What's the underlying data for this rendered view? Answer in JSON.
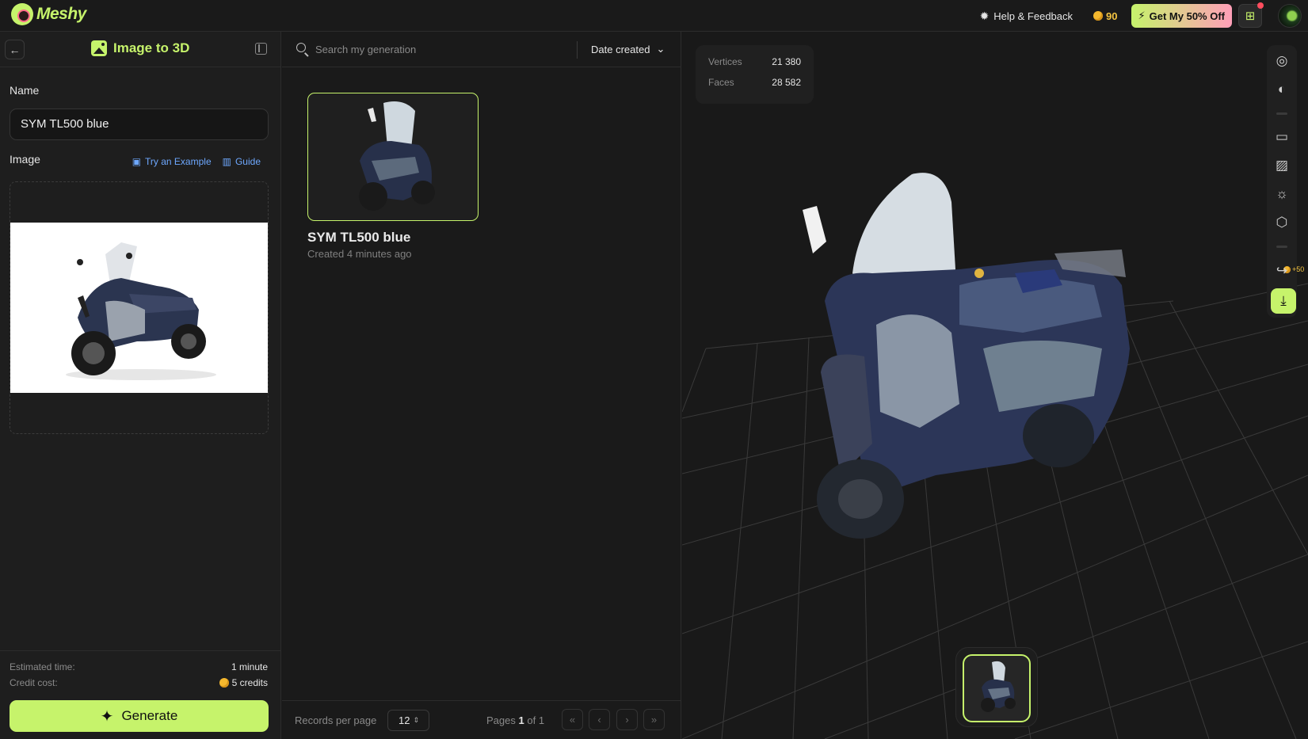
{
  "app": {
    "logo_text": "Meshy",
    "help_label": "Help & Feedback",
    "credits": "90",
    "promo_label": "Get My 50% Off"
  },
  "left_panel": {
    "title": "Image to 3D",
    "name_label": "Name",
    "name_value": "SYM TL500 blue",
    "image_label": "Image",
    "try_example_label": "Try an Example",
    "guide_label": "Guide",
    "estimated_time_label": "Estimated time:",
    "estimated_time_value": "1 minute",
    "credit_cost_label": "Credit cost:",
    "credit_cost_value": "5 credits",
    "generate_label": "Generate"
  },
  "middle_panel": {
    "search_placeholder": "Search my generation",
    "sort_label": "Date created",
    "card": {
      "title": "SYM TL500 blue",
      "subtitle": "Created 4 minutes ago"
    },
    "pager": {
      "records_per_page_label": "Records per page",
      "records_per_page_value": "12",
      "pages_prefix": "Pages",
      "current_page": "1",
      "of_label": "of",
      "total_pages": "1"
    }
  },
  "viewer": {
    "vertices_label": "Vertices",
    "vertices_value": "21 380",
    "faces_label": "Faces",
    "faces_value": "28 582",
    "bonus_label": "+50"
  },
  "colors": {
    "accent": "#c6f36b",
    "link": "#6ea8ff",
    "coin": "#f5b82e"
  }
}
